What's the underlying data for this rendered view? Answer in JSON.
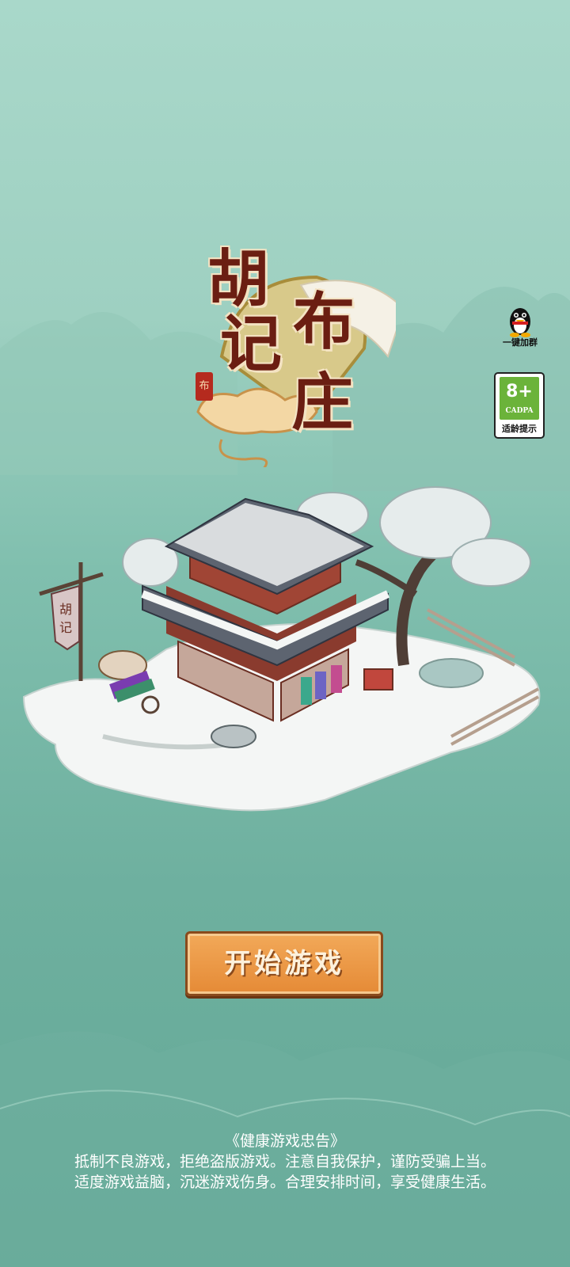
{
  "logo": {
    "title_line1": "胡",
    "title_line2": "记",
    "title_line3": "布",
    "title_line4": "庄",
    "seal": "布"
  },
  "side": {
    "qq_label": "一键加群",
    "age_rating": "8+",
    "age_org": "CADPA",
    "age_label": "适龄提示"
  },
  "scene": {
    "banner_text_1": "胡",
    "banner_text_2": "记"
  },
  "start_button": "开始游戏",
  "health_advice": {
    "title": "《健康游戏忠告》",
    "line1": "抵制不良游戏，拒绝盗版游戏。注意自我保护，谨防受骗上当。",
    "line2": "适度游戏益脑，沉迷游戏伤身。合理安排时间，享受健康生活。"
  },
  "colors": {
    "background_top": "#a9d8ca",
    "background_bottom": "#63a896",
    "button": "#e58a36",
    "logo_text": "#6b1e12",
    "age_green": "#6bb33a"
  },
  "icons": [
    "qq-penguin-icon",
    "age-rating-icon"
  ]
}
